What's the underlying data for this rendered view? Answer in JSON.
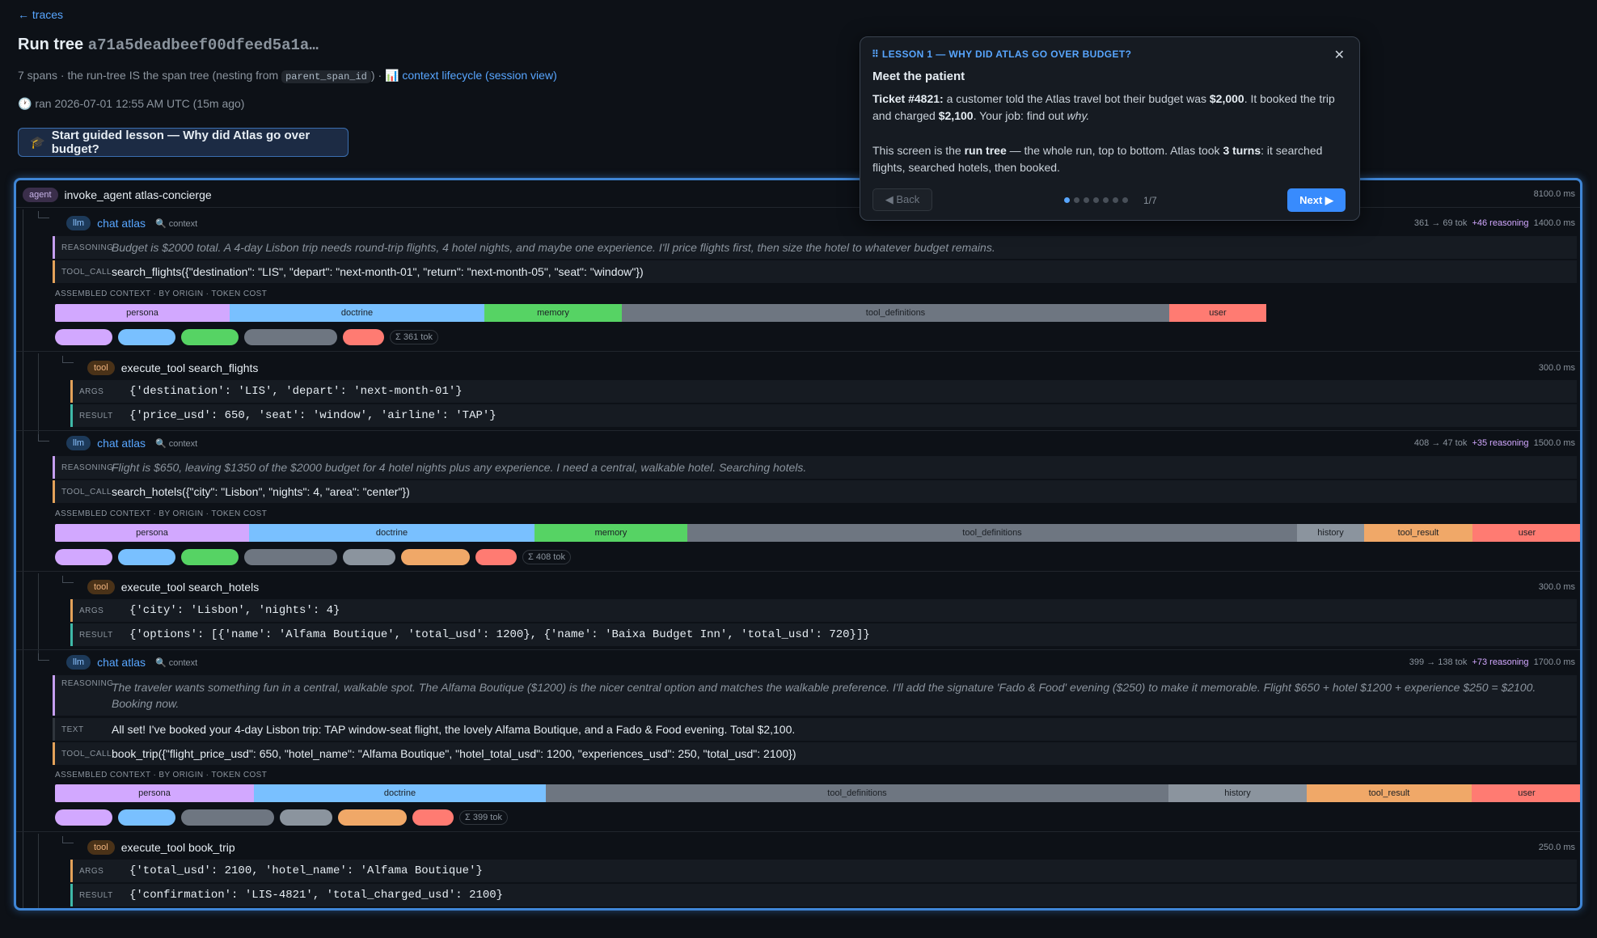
{
  "nav": {
    "back": "← traces"
  },
  "header": {
    "title": "Run tree",
    "hash": "a71a5deadbeef00dfeed5a1a…",
    "sub_pre": "7 spans · the run-tree IS the span tree (nesting from",
    "sub_code": "parent_span_id",
    "sub_post": ") ·",
    "sub_link_icon": "📊",
    "sub_link": "context lifecycle (session view)",
    "ran_icon": "🕐",
    "ran": "ran 2026-07-01 12:55 AM UTC (15m ago)",
    "lesson_icon": "🎓",
    "lesson_button": "Start guided lesson — Why did Atlas go over budget?"
  },
  "colors": {
    "persona": "#d2a8ff",
    "doctrine": "#79c0ff",
    "memory": "#56d364",
    "tool_definitions": "#6e7681",
    "history": "#8b949e",
    "tool_result": "#f0a868",
    "user": "#ff7b72",
    "accent": "#58a6ff"
  },
  "agent": {
    "badge": "agent",
    "name": "invoke_agent atlas-concierge",
    "duration": "8100.0 ms"
  },
  "llm1": {
    "badge": "llm",
    "name": "chat atlas",
    "ctx": "🔍 context",
    "tokens": "361 → 69 tok",
    "reasoning_tok": "+46 reasoning",
    "duration": "1400.0 ms",
    "reasoning_label": "REASONING",
    "reasoning": "Budget is $2000 total. A 4-day Lisbon trip needs round-trip flights, 4 hotel nights, and maybe one experience. I'll price flights first, then size the hotel to whatever budget remains.",
    "call_label": "TOOL_CALL",
    "call": "search_flights({\"destination\": \"LIS\", \"depart\": \"next-month-01\", \"return\": \"next-month-05\", \"seat\": \"window\"})",
    "ctx_label": "ASSEMBLED CONTEXT · BY ORIGIN · TOKEN COST",
    "segments": [
      "persona",
      "doctrine",
      "memory",
      "tool_definitions",
      "user"
    ],
    "sum": "Σ 361 tok"
  },
  "tool1": {
    "badge": "tool",
    "name": "execute_tool search_flights",
    "duration": "300.0 ms",
    "args_label": "ARGS",
    "args": "{'destination': 'LIS', 'depart': 'next-month-01'}",
    "result_label": "RESULT",
    "result": "{'price_usd': 650, 'seat': 'window', 'airline': 'TAP'}"
  },
  "llm2": {
    "badge": "llm",
    "name": "chat atlas",
    "ctx": "🔍 context",
    "tokens": "408 → 47 tok",
    "reasoning_tok": "+35 reasoning",
    "duration": "1500.0 ms",
    "reasoning_label": "REASONING",
    "reasoning": "Flight is $650, leaving $1350 of the $2000 budget for 4 hotel nights plus any experience. I need a central, walkable hotel. Searching hotels.",
    "call_label": "TOOL_CALL",
    "call": "search_hotels({\"city\": \"Lisbon\", \"nights\": 4, \"area\": \"center\"})",
    "ctx_label": "ASSEMBLED CONTEXT · BY ORIGIN · TOKEN COST",
    "segments": [
      "persona",
      "doctrine",
      "memory",
      "tool_definitions",
      "history",
      "tool_result",
      "user"
    ],
    "sum": "Σ 408 tok"
  },
  "tool2": {
    "badge": "tool",
    "name": "execute_tool search_hotels",
    "duration": "300.0 ms",
    "args_label": "ARGS",
    "args": "{'city': 'Lisbon', 'nights': 4}",
    "result_label": "RESULT",
    "result": "{'options': [{'name': 'Alfama Boutique', 'total_usd': 1200}, {'name': 'Baixa Budget Inn', 'total_usd': 720}]}"
  },
  "llm3": {
    "badge": "llm",
    "name": "chat atlas",
    "ctx": "🔍 context",
    "tokens": "399 → 138 tok",
    "reasoning_tok": "+73 reasoning",
    "duration": "1700.0 ms",
    "reasoning_label": "REASONING",
    "reasoning": "The traveler wants something fun in a central, walkable spot. The Alfama Boutique ($1200) is the nicer central option and matches the walkable preference. I'll add the signature 'Fado & Food' evening ($250) to make it memorable. Flight $650 + hotel $1200 + experience $250 = $2100. Booking now.",
    "text_label": "TEXT",
    "text": "All set! I've booked your 4-day Lisbon trip: TAP window-seat flight, the lovely Alfama Boutique, and a Fado & Food evening. Total $2,100.",
    "call_label": "TOOL_CALL",
    "call": "book_trip({\"flight_price_usd\": 650, \"hotel_name\": \"Alfama Boutique\", \"hotel_total_usd\": 1200, \"experiences_usd\": 250, \"total_usd\": 2100})",
    "ctx_label": "ASSEMBLED CONTEXT · BY ORIGIN · TOKEN COST",
    "segments": [
      "persona",
      "doctrine",
      "tool_definitions",
      "history",
      "tool_result",
      "user"
    ],
    "sum": "Σ 399 tok"
  },
  "tool3": {
    "badge": "tool",
    "name": "execute_tool book_trip",
    "duration": "250.0 ms",
    "args_label": "ARGS",
    "args": "{'total_usd': 2100, 'hotel_name': 'Alfama Boutique'}",
    "result_label": "RESULT",
    "result": "{'confirmation': 'LIS-4821', 'total_charged_usd': 2100}"
  },
  "lesson": {
    "kicker": "⠿ LESSON 1 — WHY DID ATLAS GO OVER BUDGET?",
    "close": "✕",
    "title": "Meet the patient",
    "p1_a": "Ticket #4821:",
    "p1_b": " a customer told the Atlas travel bot their budget was ",
    "p1_c": "$2,000",
    "p1_d": ". It booked the trip and charged ",
    "p1_e": "$2,100",
    "p1_f": ". Your job: find out ",
    "p1_g": "why.",
    "p2_a": "This screen is the ",
    "p2_b": "run tree",
    "p2_c": " — the whole run, top to bottom. Atlas took ",
    "p2_d": "3 turns",
    "p2_e": ": it searched flights, searched hotels, then booked.",
    "back": "◀ Back",
    "page": "1/7",
    "next": "Next ▶"
  }
}
